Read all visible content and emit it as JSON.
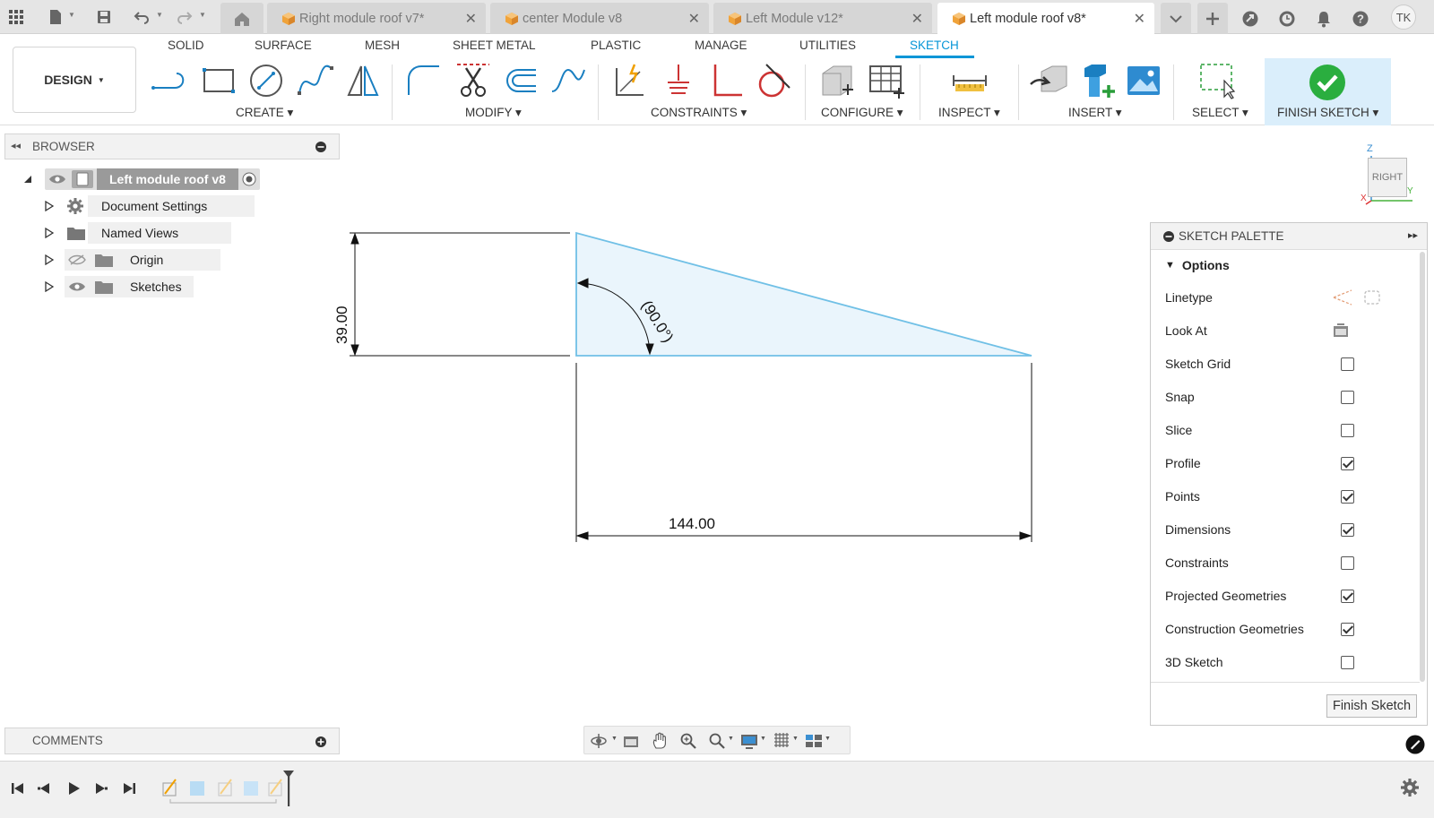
{
  "app": {
    "accent": "#0696d7",
    "user_initials": "TK"
  },
  "doc_tabs": [
    {
      "label": "Right module roof v7*",
      "active": false
    },
    {
      "label": "center Module v8",
      "active": false
    },
    {
      "label": "Left Module v12*",
      "active": false
    },
    {
      "label": "Left module roof v8*",
      "active": true
    }
  ],
  "ribbon": {
    "workspace": "DESIGN",
    "tabs": [
      "SOLID",
      "SURFACE",
      "MESH",
      "SHEET METAL",
      "PLASTIC",
      "MANAGE",
      "UTILITIES",
      "SKETCH"
    ],
    "active_tab": "SKETCH",
    "groups": {
      "create": "CREATE",
      "modify": "MODIFY",
      "constraints": "CONSTRAINTS",
      "configure": "CONFIGURE",
      "inspect": "INSPECT",
      "insert": "INSERT",
      "select": "SELECT",
      "finish": "FINISH SKETCH"
    }
  },
  "browser": {
    "title": "BROWSER",
    "root": "Left module roof v8",
    "items": [
      "Document Settings",
      "Named Views",
      "Origin",
      "Sketches"
    ]
  },
  "sketch": {
    "vertical_dim": "39.00",
    "horizontal_dim": "144.00",
    "angle_dim": "(90.0°)"
  },
  "viewcube": {
    "face": "RIGHT",
    "axis_z": "Z",
    "axis_y": "Y",
    "axis_x": "X"
  },
  "palette": {
    "title": "SKETCH PALETTE",
    "section": "Options",
    "rows": [
      {
        "label": "Linetype",
        "kind": "icons"
      },
      {
        "label": "Look At",
        "kind": "icon"
      },
      {
        "label": "Sketch Grid",
        "checked": false
      },
      {
        "label": "Snap",
        "checked": false
      },
      {
        "label": "Slice",
        "checked": false
      },
      {
        "label": "Profile",
        "checked": true
      },
      {
        "label": "Points",
        "checked": true
      },
      {
        "label": "Dimensions",
        "checked": true
      },
      {
        "label": "Constraints",
        "checked": false
      },
      {
        "label": "Projected Geometries",
        "checked": true
      },
      {
        "label": "Construction Geometries",
        "checked": true
      },
      {
        "label": "3D Sketch",
        "checked": false
      }
    ],
    "finish_button": "Finish Sketch"
  },
  "comments": {
    "title": "COMMENTS"
  }
}
